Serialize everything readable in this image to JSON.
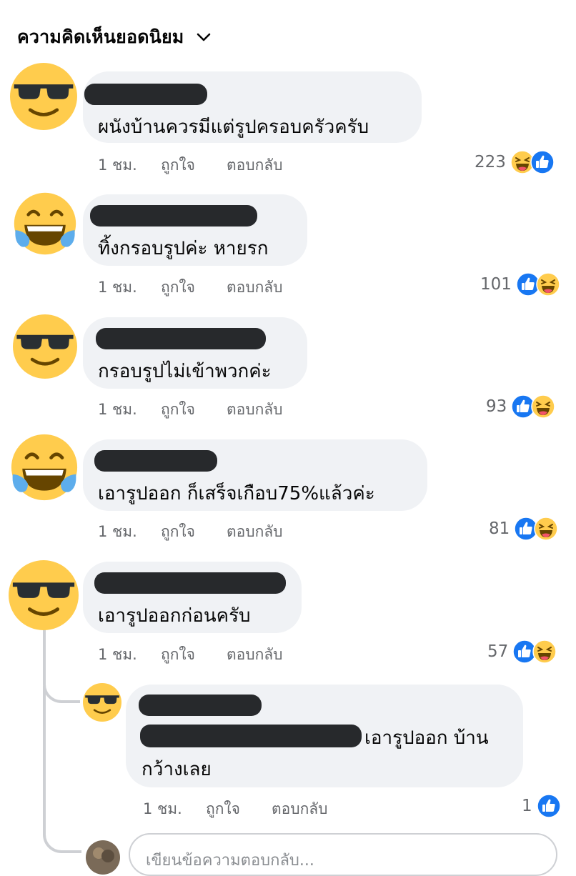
{
  "header": {
    "title": "ความคิดเห็นยอดนิยม"
  },
  "common": {
    "time": "1 ชม.",
    "like": "ถูกใจ",
    "reply": "ตอบกลับ"
  },
  "comments": [
    {
      "text": "ผนังบ้านควรมีแต่รูปครอบครัวครับ",
      "count": "223"
    },
    {
      "text": "ทิ้งกรอบรูปค่ะ หายรก",
      "count": "101"
    },
    {
      "text": "กรอบรูปไม่เข้าพวกค่ะ",
      "count": "93"
    },
    {
      "text": "เอารูปออก ก็เสร็จเกือบ75%แล้วค่ะ",
      "count": "81"
    },
    {
      "text": "เอารูปออกก่อนครับ",
      "count": "57"
    }
  ],
  "reply": {
    "line1": "เอารูปออก บ้าน",
    "line2": "กว้างเลย",
    "count": "1"
  },
  "reply_box": {
    "placeholder": "เขียนข้อความตอบกลับ..."
  }
}
